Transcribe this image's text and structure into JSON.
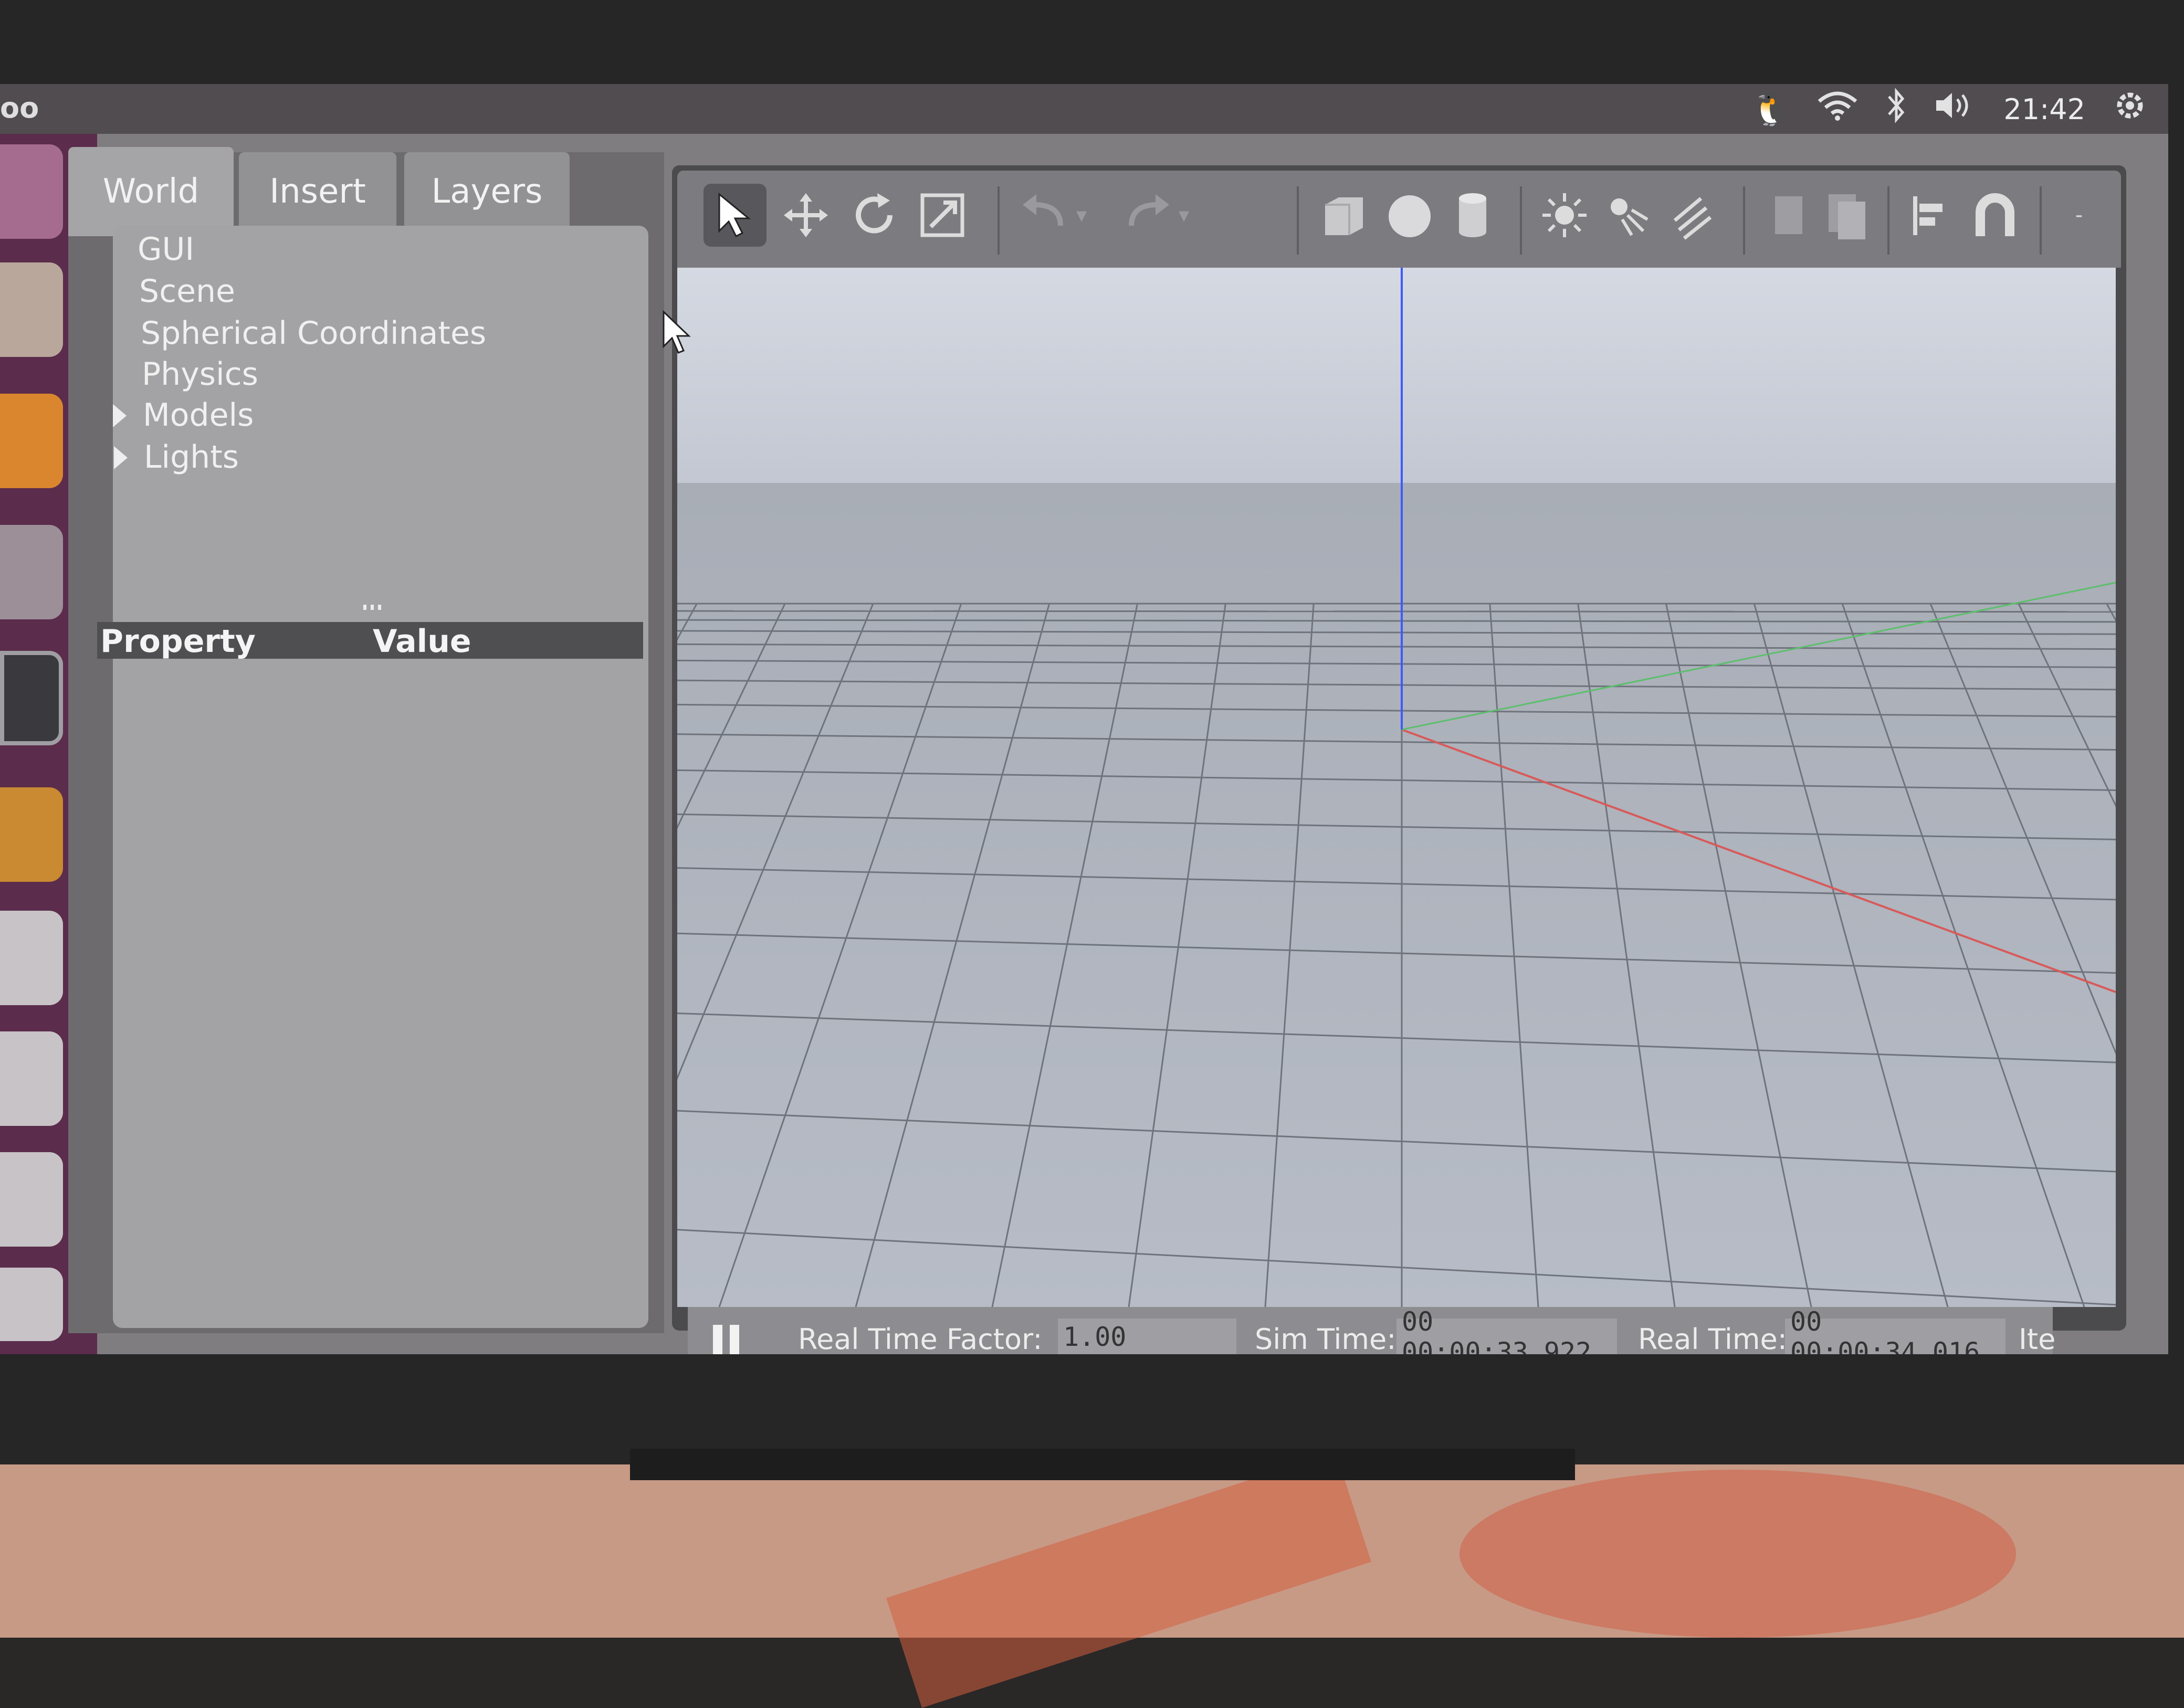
{
  "topbar": {
    "app_title": "oo",
    "clock": "21:42",
    "tray_icons": [
      "tux-icon",
      "wifi-icon",
      "bluetooth-icon",
      "volume-icon",
      "power-gear-icon"
    ]
  },
  "launcher": {
    "icons": [
      "dash-icon",
      "files-icon",
      "firefox-icon",
      "settings-icon",
      "terminal-icon",
      "gazebo-icon",
      "drive-icon",
      "drive-icon",
      "drive-icon",
      "workspace-icon"
    ]
  },
  "left_panel": {
    "tabs": [
      "World",
      "Insert",
      "Layers"
    ],
    "active_tab": "World",
    "tree": [
      {
        "label": "GUI",
        "expandable": false
      },
      {
        "label": "Scene",
        "expandable": false
      },
      {
        "label": "Spherical Coordinates",
        "expandable": false
      },
      {
        "label": "Physics",
        "expandable": false
      },
      {
        "label": "Models",
        "expandable": true
      },
      {
        "label": "Lights",
        "expandable": true
      }
    ],
    "property_header": {
      "property": "Property",
      "value": "Value"
    }
  },
  "toolbar": {
    "tools": [
      "select-icon",
      "translate-icon",
      "rotate-icon",
      "scale-icon",
      "undo-icon",
      "undo-dropdown-icon",
      "redo-icon",
      "redo-dropdown-icon",
      "box-icon",
      "sphere-icon",
      "cylinder-icon",
      "point-light-icon",
      "spot-light-icon",
      "directional-light-icon",
      "copy-icon",
      "paste-icon",
      "align-icon",
      "magnet-icon"
    ]
  },
  "statusbar": {
    "real_time_factor_label": "Real Time Factor:",
    "real_time_factor": "1.00",
    "sim_time_label": "Sim Time:",
    "sim_time": "00 00:00:33.922",
    "real_time_label": "Real Time:",
    "real_time": "00 00:00:34.016",
    "iterations_label": "Ite"
  },
  "colors": {
    "x_axis": "#d85a5a",
    "y_axis": "#5cbf6c",
    "z_axis": "#3b5cff",
    "sky": "#c6cbd6",
    "ground": "#a9aeb7",
    "launcher": "#5b2c4b"
  }
}
